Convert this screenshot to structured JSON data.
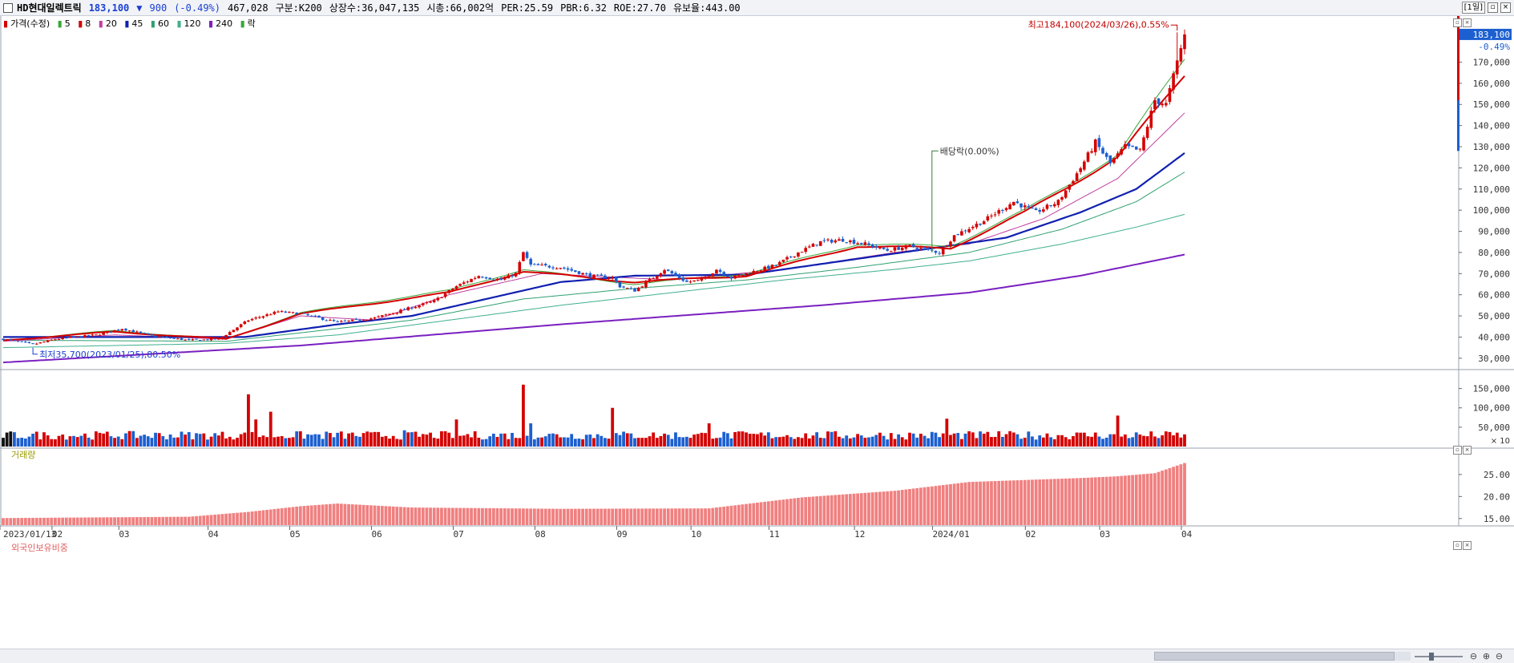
{
  "header": {
    "name": "HD현대일렉트릭",
    "price": "183,100",
    "change_arrow": "▼",
    "change": "900",
    "change_pct": "(-0.49%)",
    "volume": "467,028",
    "category": "구분:K200",
    "shares": "상장수:36,047,135",
    "market_cap": "시총:66,002억",
    "per": "PER:25.59",
    "pbr": "PBR:6.32",
    "roe": "ROE:27.70",
    "retention": "유보율:443.00",
    "period": "[1일]"
  },
  "colors": {
    "up": "#d40000",
    "down": "#1c5fd0",
    "ma5": "#3aa63a",
    "ma8": "#d40000",
    "ma20": "#c040a0",
    "ma45": "#1020b0",
    "ma60": "#30a070",
    "ma120": "#40b090",
    "ma240": "#7a20c0",
    "foreign_bar": "#f08080"
  },
  "price_legend": {
    "items": [
      {
        "label": "가격(수정)",
        "color": "#d40000"
      },
      {
        "label": "5",
        "color": "#3aa63a"
      },
      {
        "label": "8",
        "color": "#d40000"
      },
      {
        "label": "20",
        "color": "#c040a0"
      },
      {
        "label": "45",
        "color": "#1020b0"
      },
      {
        "label": "60",
        "color": "#30a070"
      },
      {
        "label": "120",
        "color": "#40b090"
      },
      {
        "label": "240",
        "color": "#7a20c0"
      },
      {
        "label": "락",
        "color": "#3aa63a"
      }
    ]
  },
  "volume_legend": "거래량",
  "foreign_legend": "외국인보유비중",
  "annotations": {
    "high": "최고184,100(2024/03/26),0.55%",
    "low": "최저35,700(2023/01/25),80.50%",
    "dividend": "배당락(0.00%)",
    "last_price": "183,100",
    "last_pct": "-0.49%",
    "volume_multiplier": "× 10"
  },
  "chart_data": [
    {
      "type": "candlestick",
      "title": "HD현대일렉트릭",
      "y_ticks": [
        "170,000",
        "160,000",
        "150,000",
        "140,000",
        "130,000",
        "120,000",
        "110,000",
        "100,000",
        "90,000",
        "80,000",
        "70,000",
        "60,000",
        "50,000",
        "40,000",
        "30,000"
      ],
      "y_tick_values": [
        170000,
        160000,
        150000,
        140000,
        130000,
        120000,
        110000,
        100000,
        90000,
        80000,
        70000,
        60000,
        50000,
        40000,
        30000
      ],
      "ylim": [
        25000,
        188000
      ],
      "x_ticks": [
        "2023/01/13",
        "02",
        "03",
        "04",
        "05",
        "06",
        "07",
        "08",
        "09",
        "10",
        "11",
        "12",
        "2024/01",
        "02",
        "03",
        "04"
      ],
      "x_tick_days": [
        0,
        14,
        32,
        56,
        78,
        100,
        122,
        144,
        166,
        186,
        207,
        230,
        251,
        276,
        296,
        318
      ],
      "close_anchors": [
        [
          0,
          39000
        ],
        [
          8,
          36500
        ],
        [
          14,
          39000
        ],
        [
          25,
          41000
        ],
        [
          32,
          44000
        ],
        [
          40,
          40500
        ],
        [
          50,
          38500
        ],
        [
          58,
          39000
        ],
        [
          66,
          48000
        ],
        [
          74,
          52000
        ],
        [
          80,
          51000
        ],
        [
          90,
          47000
        ],
        [
          100,
          49000
        ],
        [
          108,
          53000
        ],
        [
          116,
          57000
        ],
        [
          122,
          64000
        ],
        [
          128,
          69000
        ],
        [
          134,
          67000
        ],
        [
          138,
          70000
        ],
        [
          140,
          80000
        ],
        [
          142,
          74000
        ],
        [
          150,
          73000
        ],
        [
          158,
          69000
        ],
        [
          164,
          68000
        ],
        [
          166,
          64000
        ],
        [
          170,
          62000
        ],
        [
          178,
          72000
        ],
        [
          184,
          66000
        ],
        [
          188,
          67000
        ],
        [
          192,
          72000
        ],
        [
          196,
          68000
        ],
        [
          202,
          71000
        ],
        [
          208,
          74000
        ],
        [
          214,
          80000
        ],
        [
          220,
          85000
        ],
        [
          226,
          86000
        ],
        [
          232,
          84000
        ],
        [
          238,
          81000
        ],
        [
          244,
          83000
        ],
        [
          252,
          80000
        ],
        [
          256,
          88000
        ],
        [
          264,
          95000
        ],
        [
          272,
          104000
        ],
        [
          278,
          99000
        ],
        [
          284,
          104000
        ],
        [
          290,
          120000
        ],
        [
          294,
          132000
        ],
        [
          298,
          122000
        ],
        [
          302,
          130000
        ],
        [
          306,
          128000
        ],
        [
          310,
          152000
        ],
        [
          313,
          150000
        ],
        [
          316,
          170000
        ],
        [
          318,
          183100
        ]
      ],
      "ma_anchors": {
        "ma5": [
          [
            0,
            38500
          ],
          [
            30,
            43000
          ],
          [
            60,
            39000
          ],
          [
            80,
            51500
          ],
          [
            120,
            62000
          ],
          [
            140,
            72000
          ],
          [
            170,
            65000
          ],
          [
            200,
            70000
          ],
          [
            230,
            84000
          ],
          [
            255,
            83000
          ],
          [
            275,
            100000
          ],
          [
            300,
            126000
          ],
          [
            318,
            172000
          ]
        ],
        "ma8": [
          [
            0,
            38500
          ],
          [
            30,
            42500
          ],
          [
            60,
            39000
          ],
          [
            80,
            51000
          ],
          [
            120,
            61000
          ],
          [
            140,
            71000
          ],
          [
            170,
            66000
          ],
          [
            200,
            69000
          ],
          [
            230,
            83000
          ],
          [
            255,
            82000
          ],
          [
            275,
            99000
          ],
          [
            300,
            125000
          ],
          [
            318,
            164000
          ]
        ],
        "ma20": [
          [
            0,
            38000
          ],
          [
            30,
            41000
          ],
          [
            60,
            39000
          ],
          [
            80,
            50000
          ],
          [
            100,
            48000
          ],
          [
            120,
            60000
          ],
          [
            145,
            70000
          ],
          [
            180,
            67000
          ],
          [
            210,
            72000
          ],
          [
            240,
            80000
          ],
          [
            260,
            84000
          ],
          [
            280,
            96000
          ],
          [
            300,
            115000
          ],
          [
            318,
            146000
          ]
        ],
        "ma45": [
          [
            0,
            40000
          ],
          [
            40,
            40000
          ],
          [
            65,
            40000
          ],
          [
            90,
            46000
          ],
          [
            110,
            50000
          ],
          [
            130,
            58000
          ],
          [
            150,
            66000
          ],
          [
            170,
            69000
          ],
          [
            200,
            69500
          ],
          [
            230,
            77000
          ],
          [
            250,
            82000
          ],
          [
            270,
            87000
          ],
          [
            290,
            99000
          ],
          [
            305,
            110000
          ],
          [
            318,
            127000
          ]
        ],
        "ma60": [
          [
            0,
            38500
          ],
          [
            60,
            38000
          ],
          [
            80,
            42000
          ],
          [
            110,
            48000
          ],
          [
            140,
            58000
          ],
          [
            170,
            63000
          ],
          [
            200,
            67000
          ],
          [
            230,
            73000
          ],
          [
            260,
            80000
          ],
          [
            285,
            91000
          ],
          [
            305,
            104000
          ],
          [
            318,
            118000
          ]
        ],
        "ma120": [
          [
            0,
            35000
          ],
          [
            60,
            37000
          ],
          [
            90,
            41000
          ],
          [
            120,
            48000
          ],
          [
            150,
            55000
          ],
          [
            180,
            61000
          ],
          [
            210,
            67000
          ],
          [
            240,
            72000
          ],
          [
            260,
            76000
          ],
          [
            285,
            84000
          ],
          [
            305,
            92000
          ],
          [
            318,
            98000
          ]
        ],
        "ma240": [
          [
            0,
            28000
          ],
          [
            80,
            36000
          ],
          [
            150,
            46000
          ],
          [
            220,
            55000
          ],
          [
            260,
            61000
          ],
          [
            290,
            69000
          ],
          [
            318,
            79000
          ]
        ]
      }
    },
    {
      "type": "bar",
      "title": "거래량",
      "y_ticks": [
        "150,000",
        "100,000",
        "50,000"
      ],
      "y_tick_values": [
        150000,
        100000,
        50000
      ],
      "ylim": [
        0,
        172000
      ],
      "spikes": [
        [
          66,
          135000
        ],
        [
          68,
          70000
        ],
        [
          72,
          90000
        ],
        [
          108,
          42000
        ],
        [
          122,
          70000
        ],
        [
          140,
          160000
        ],
        [
          142,
          60000
        ],
        [
          164,
          100000
        ],
        [
          190,
          60000
        ],
        [
          254,
          72000
        ],
        [
          300,
          80000
        ]
      ]
    },
    {
      "type": "bar",
      "title": "외국인보유비중",
      "y_ticks": [
        "25.00",
        "20.00",
        "15.00"
      ],
      "y_tick_values": [
        25,
        20,
        15
      ],
      "ylim": [
        13.5,
        28.8
      ],
      "anchors": [
        [
          0,
          15.1
        ],
        [
          50,
          15.4
        ],
        [
          66,
          16.5
        ],
        [
          80,
          17.8
        ],
        [
          90,
          18.4
        ],
        [
          110,
          17.5
        ],
        [
          150,
          17.2
        ],
        [
          190,
          17.3
        ],
        [
          215,
          19.8
        ],
        [
          240,
          21.3
        ],
        [
          260,
          23.3
        ],
        [
          290,
          24.2
        ],
        [
          300,
          24.6
        ],
        [
          310,
          25.3
        ],
        [
          318,
          27.6
        ]
      ]
    }
  ]
}
